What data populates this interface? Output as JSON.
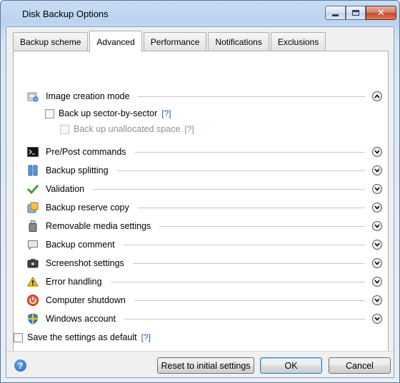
{
  "window": {
    "title": "Disk Backup Options"
  },
  "tabs": [
    {
      "label": "Backup scheme",
      "active": false
    },
    {
      "label": "Advanced",
      "active": true
    },
    {
      "label": "Performance",
      "active": false
    },
    {
      "label": "Notifications",
      "active": false
    },
    {
      "label": "Exclusions",
      "active": false
    }
  ],
  "sections": [
    {
      "label": "Image creation mode",
      "icon": "disk-image-icon",
      "expanded": true
    },
    {
      "label": "Pre/Post commands",
      "icon": "console-icon",
      "expanded": false
    },
    {
      "label": "Backup splitting",
      "icon": "split-archive-icon",
      "expanded": false
    },
    {
      "label": "Validation",
      "icon": "checkmark-icon",
      "expanded": false
    },
    {
      "label": "Backup reserve copy",
      "icon": "reserve-copy-icon",
      "expanded": false
    },
    {
      "label": "Removable media settings",
      "icon": "usb-drive-icon",
      "expanded": false
    },
    {
      "label": "Backup comment",
      "icon": "comment-bubble-icon",
      "expanded": false
    },
    {
      "label": "Screenshot settings",
      "icon": "camera-icon",
      "expanded": false
    },
    {
      "label": "Error handling",
      "icon": "warning-icon",
      "expanded": false
    },
    {
      "label": "Computer shutdown",
      "icon": "power-icon",
      "expanded": false
    },
    {
      "label": "Windows account",
      "icon": "shield-icon",
      "expanded": false
    }
  ],
  "image_mode": {
    "sector_by_sector": {
      "label": "Back up sector-by-sector",
      "help": "[?]",
      "checked": false
    },
    "unallocated": {
      "label": "Back up unallocated space",
      "help": "[?]",
      "checked": false,
      "enabled": false
    }
  },
  "footer": {
    "save_default": {
      "label": "Save the settings as default",
      "help": "[?]",
      "checked": false
    },
    "reset_label": "Reset to initial settings",
    "ok_label": "OK",
    "cancel_label": "Cancel",
    "help_glyph": "?"
  }
}
